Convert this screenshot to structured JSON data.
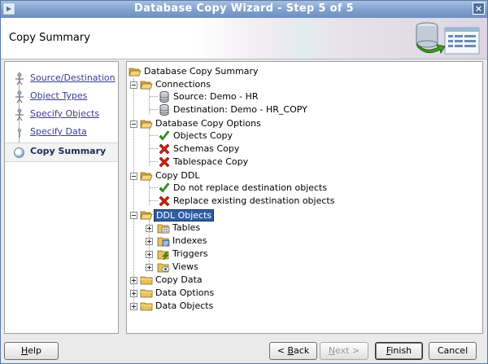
{
  "window": {
    "title": "Database Copy Wizard - Step 5 of 5",
    "close_glyph": "×"
  },
  "header": {
    "title": "Copy Summary"
  },
  "nav": {
    "items": [
      {
        "label": "Source/Destination",
        "current": false
      },
      {
        "label": "Object Types",
        "current": false
      },
      {
        "label": "Specify Objects",
        "current": false
      },
      {
        "label": "Specify Data",
        "current": false
      },
      {
        "label": "Copy Summary",
        "current": true
      }
    ]
  },
  "tree": {
    "root": "Database Copy Summary",
    "connections": {
      "label": "Connections",
      "source": "Source: Demo - HR",
      "destination": "Destination: Demo - HR_COPY"
    },
    "options": {
      "label": "Database Copy Options",
      "objects_copy": "Objects Copy",
      "schemas_copy": "Schemas Copy",
      "tablespace_copy": "Tablespace Copy"
    },
    "copy_ddl": {
      "label": "Copy DDL",
      "no_replace": "Do not replace destination objects",
      "replace": "Replace existing destination objects"
    },
    "ddl_objects": {
      "label": "DDL Objects",
      "tables": "Tables",
      "indexes": "Indexes",
      "triggers": "Triggers",
      "views": "Views"
    },
    "copy_data": "Copy Data",
    "data_options": "Data Options",
    "data_objects": "Data Objects"
  },
  "buttons": {
    "help_pre": "",
    "help_key": "H",
    "help_post": "elp",
    "back_pre": "< ",
    "back_key": "B",
    "back_post": "ack",
    "next_pre": "",
    "next_key": "N",
    "next_post": "ext >",
    "finish_pre": "",
    "finish_key": "F",
    "finish_post": "inish",
    "cancel_label": "Cancel"
  },
  "colors": {
    "title_bar": "#7f9fcd",
    "selection": "#2f5ea6",
    "check_green": "#2e9a1e",
    "cross_red": "#d02010",
    "folder": "#e8c25a"
  }
}
